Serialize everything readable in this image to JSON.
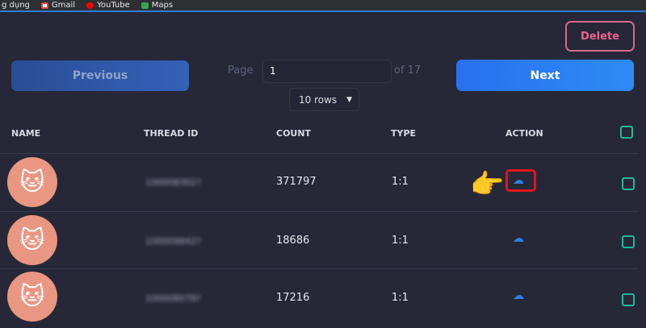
{
  "bookmarks": [
    {
      "label": "g dụng",
      "color": "#888888"
    },
    {
      "label": "Gmail",
      "color": "#e8453c"
    },
    {
      "label": "YouTube",
      "color": "#ff0000"
    },
    {
      "label": "Maps",
      "color": "#34a853"
    }
  ],
  "controls": {
    "previous": "Previous",
    "next": "Next",
    "delete": "Delete",
    "page_label": "Page",
    "page_value": "1",
    "of_label": "of 17",
    "rows_select": "10 rows"
  },
  "headers": {
    "name": "NAME",
    "thread_id": "THREAD ID",
    "count": "COUNT",
    "type": "TYPE",
    "action": "ACTION"
  },
  "rows": [
    {
      "thread_id": "100008302?",
      "count": "371797",
      "type": "1:1",
      "highlighted": true
    },
    {
      "thread_id": "100009842?",
      "count": "18686",
      "type": "1:1",
      "highlighted": false
    },
    {
      "thread_id": "100008078?",
      "count": "17216",
      "type": "1:1",
      "highlighted": false
    }
  ],
  "colors": {
    "accent": "#2f7de6",
    "delete": "#e8618c",
    "checkbox": "#1fb79a",
    "highlight": "#e0141e"
  }
}
